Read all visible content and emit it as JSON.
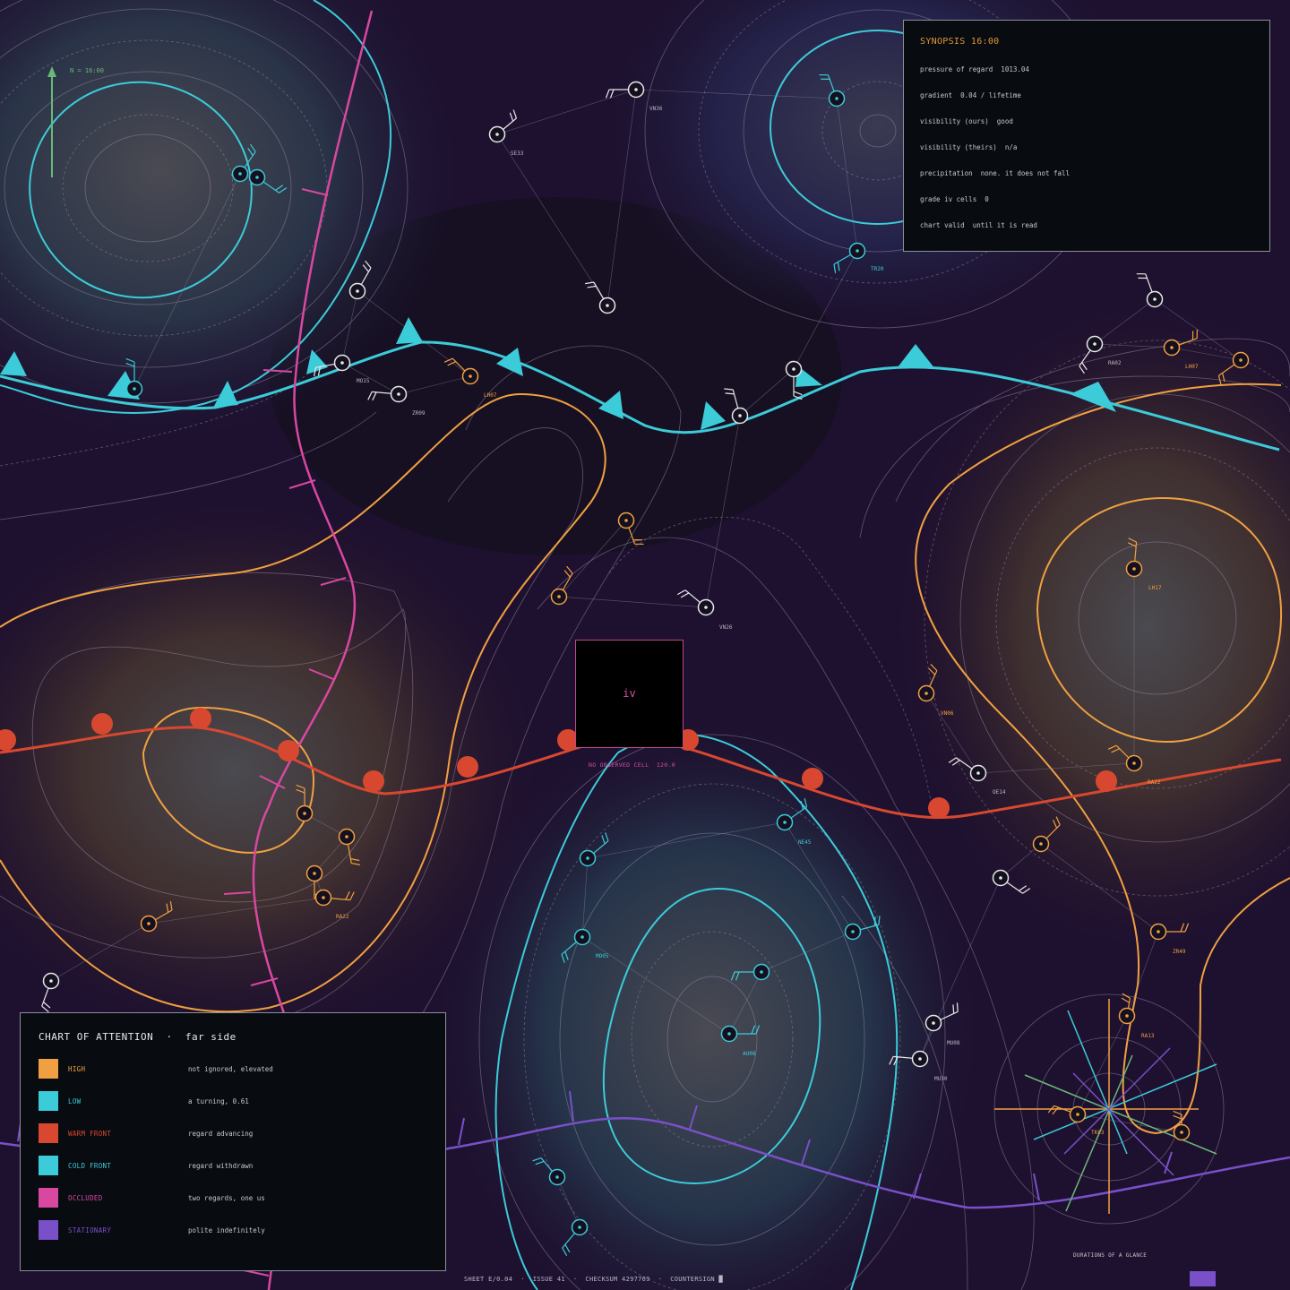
{
  "synopsis": {
    "title": "SYNOPSIS 16:00",
    "lines": [
      "pressure of regard  1013.04",
      "gradient  0.04 / lifetime",
      "visibility (ours)  good",
      "visibility (theirs)  n/a",
      "precipitation  none. it does not fall",
      "grade iv cells  0",
      "chart valid  until it is read"
    ]
  },
  "legend": {
    "title": "CHART OF ATTENTION  ·  far side",
    "items": [
      {
        "name": "HIGH",
        "desc": "not ignored, elevated",
        "color": "#f0a040"
      },
      {
        "name": "LOW",
        "desc": "a turning, 0.61",
        "color": "#3ccbd8"
      },
      {
        "name": "WARM FRONT",
        "desc": "regard advancing",
        "color": "#d84830"
      },
      {
        "name": "COLD FRONT",
        "desc": "regard withdrawn",
        "color": "#3ccbd8"
      },
      {
        "name": "OCCLUDED",
        "desc": "two regards, one us",
        "color": "#d848a0"
      },
      {
        "name": "STATIONARY",
        "desc": "polite indefinitely",
        "color": "#7a50c8"
      }
    ]
  },
  "center_cell": {
    "label": "iv",
    "caption": "NO OBSERVED CELL  120.0"
  },
  "north_label": "N = 16:00",
  "footer": "SHEET E/0.04  ·  ISSUE 41  ·  CHECKSUM 4297769  ·  COUNTERSIGN █",
  "durations_label": "DURATIONS OF A GLANCE",
  "stations": [
    {
      "id": "SE33",
      "kind": "neutral"
    },
    {
      "id": "VN36",
      "kind": "neutral"
    },
    {
      "id": "MO15",
      "kind": "neutral"
    },
    {
      "id": "ZR09",
      "kind": "neutral"
    },
    {
      "id": "LH07",
      "kind": "high"
    },
    {
      "id": "RA02",
      "kind": "neutral"
    },
    {
      "id": "LH07",
      "kind": "high"
    },
    {
      "id": "TR20",
      "kind": "low"
    },
    {
      "id": "LH17",
      "kind": "high"
    },
    {
      "id": "VN26",
      "kind": "neutral"
    },
    {
      "id": "VN06",
      "kind": "high"
    },
    {
      "id": "OE14",
      "kind": "neutral"
    },
    {
      "id": "RA22",
      "kind": "high"
    },
    {
      "id": "NE45",
      "kind": "low"
    },
    {
      "id": "MO05",
      "kind": "low"
    },
    {
      "id": "AU08",
      "kind": "low"
    },
    {
      "id": "ZR49",
      "kind": "high"
    },
    {
      "id": "RA13",
      "kind": "high"
    },
    {
      "id": "MU08",
      "kind": "neutral"
    },
    {
      "id": "MU30",
      "kind": "neutral"
    },
    {
      "id": "TK03",
      "kind": "high"
    },
    {
      "id": "RA22",
      "kind": "high"
    }
  ],
  "colors": {
    "high": "#f0a040",
    "low": "#3ccbd8",
    "warm_front": "#d84830",
    "cold_front": "#3ccbd8",
    "occluded": "#d848a0",
    "stationary": "#7a50c8",
    "background": "#1a1028"
  }
}
